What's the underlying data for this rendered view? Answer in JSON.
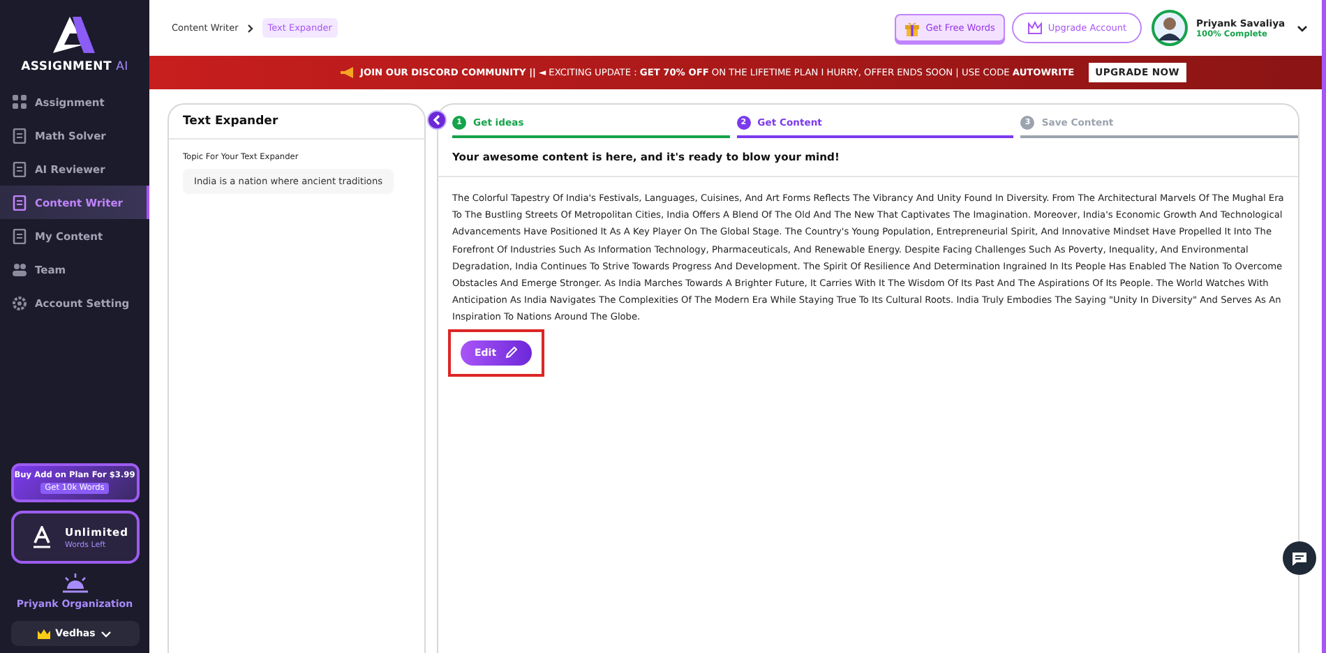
{
  "brand": {
    "name": "ASSIGNMENT",
    "suffix": "AI"
  },
  "sidebar": {
    "items": [
      {
        "label": "Assignment",
        "selected": false
      },
      {
        "label": "Math Solver",
        "selected": false
      },
      {
        "label": "AI Reviewer",
        "selected": false
      },
      {
        "label": "Content Writer",
        "selected": true
      },
      {
        "label": "My Content",
        "selected": false
      },
      {
        "label": "Team",
        "selected": false
      },
      {
        "label": "Account Setting",
        "selected": false
      }
    ],
    "addon": {
      "text": "Buy Add on Plan For $3.99",
      "button": "Get 10k Words"
    },
    "plan": {
      "title": "Unlimited",
      "subtitle": "Words Left"
    },
    "organization": "Priyank Organization",
    "workspace": "Vedhas"
  },
  "breadcrumb": [
    "Content Writer",
    "Text Expander"
  ],
  "header": {
    "free_words": "Get Free Words",
    "upgrade": "Upgrade Account",
    "user": {
      "name": "Priyank Savaliya",
      "progress": "100% Complete"
    }
  },
  "banner": {
    "text": "**JOIN OUR DISCORD COMMUNITY ||** ◄ EXCITING UPDATE : **GET 70% OFF** ON THE LIFETIME PLAN I HURRY, OFFER ENDS SOON | USE CODE **AUTOWRITE**",
    "button": "UPGRADE NOW"
  },
  "left_panel": {
    "title": "Text Expander",
    "field_label": "Topic For Your Text Expander",
    "field_value": "India is a nation where ancient traditions"
  },
  "steps": [
    {
      "number": "1",
      "label": "Get ideas",
      "kind": "done"
    },
    {
      "number": "2",
      "label": "Get Content",
      "kind": "current"
    },
    {
      "number": "3",
      "label": "Save Content",
      "kind": "pending"
    }
  ],
  "content": {
    "heading": "Your awesome content is here, and it's ready to blow your mind!",
    "body": "The Colorful Tapestry Of India's Festivals, Languages, Cuisines, And Art Forms Reflects The Vibrancy And Unity Found In Diversity. From The Architectural Marvels Of The Mughal Era To The Bustling Streets Of Metropolitan Cities, India Offers A Blend Of The Old And The New That Captivates The Imagination. Moreover, India's Economic Growth And Technological Advancements Have Positioned It As A Key Player On The Global Stage. The Country's Young Population, Entrepreneurial Spirit, And Innovative Mindset Have Propelled It Into The Forefront Of Industries Such As Information Technology, Pharmaceuticals, And Renewable Energy. Despite Facing Challenges Such As Poverty, Inequality, And Environmental Degradation, India Continues To Strive Towards Progress And Development. The Spirit Of Resilience And Determination Ingrained In Its People Has Enabled The Nation To Overcome Obstacles And Emerge Stronger. As India Marches Towards A Brighter Future, It Carries With It The Wisdom Of Its Past And The Aspirations Of Its People. The World Watches With Anticipation As India Navigates The Complexities Of The Modern Era While Staying True To Its Cultural Roots. India Truly Embodies The Saying \"Unity In Diversity\" And Serves As An Inspiration To Nations Around The Globe.",
    "edit_button": {
      "label": "Edit",
      "highlighted": true
    }
  }
}
